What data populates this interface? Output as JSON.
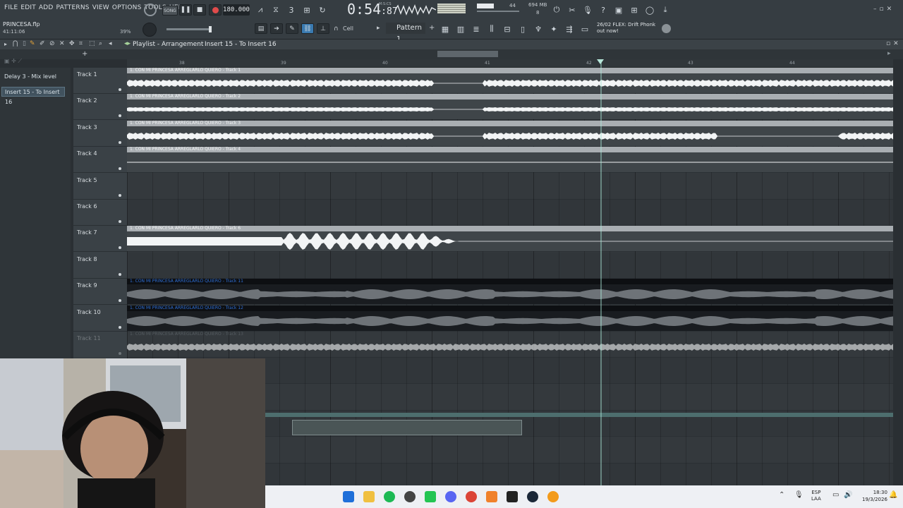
{
  "menu": [
    "FILE",
    "EDIT",
    "ADD",
    "PATTERNS",
    "VIEW",
    "OPTIONS",
    "TOOLS",
    "HELP"
  ],
  "project": {
    "file": "PRINCESA.flp",
    "time": "41:11:06"
  },
  "transport": {
    "mode": "SONG",
    "bpm": "180.000",
    "time": "0:54",
    "time_frac": ":87",
    "time_label": "M:S:CS"
  },
  "monitor": {
    "memory": "694 MB",
    "cpu": "44",
    "voices": "8"
  },
  "cpu_percent": "39%",
  "pattern": {
    "snap": "Cell",
    "name": "Pattern 1"
  },
  "news": {
    "line1": "26/02  FLEX: Drift Phonk",
    "line2": "out now!"
  },
  "playlist": {
    "title": "Playlist - Arrangement",
    "crumb": "Insert 15 - To Insert 16"
  },
  "left_tabs": [
    "Delay 3 - Mix level",
    "Insert 15 - To Insert 16"
  ],
  "ruler_ticks": [
    "38",
    "39",
    "40",
    "41",
    "42",
    "43",
    "44"
  ],
  "tracks": [
    {
      "name": "Track 1"
    },
    {
      "name": "Track 2"
    },
    {
      "name": "Track 3"
    },
    {
      "name": "Track 4"
    },
    {
      "name": "Track 5"
    },
    {
      "name": "Track 6"
    },
    {
      "name": "Track 7"
    },
    {
      "name": "Track 8"
    },
    {
      "name": "Track 9"
    },
    {
      "name": "Track 10"
    },
    {
      "name": "Track 11"
    }
  ],
  "clips": [
    {
      "label": "1. CON MI PRINCESA ARREGLARLO QUIERO - Track 1"
    },
    {
      "label": "1. CON MI PRINCESA ARREGLARLO QUIERO - Track 2"
    },
    {
      "label": "1. CON MI PRINCESA ARREGLARLO QUIERO - Track 3"
    },
    {
      "label": "1. CON MI PRINCESA ARREGLARLO QUIERO - Track 4"
    },
    {
      "label": "1. CON MI PRINCESA ARREGLARLO QUIERO - Track 6"
    },
    {
      "label": "1. CON MI PRINCESA ARREGLARLO QUIERO - Track 11"
    },
    {
      "label": "1. CON MI PRINCESA ARREGLARLO QUIERO - Track 12"
    },
    {
      "label": "1. CON MI PRINCESA ARREGLARLO QUIERO - Track 13"
    }
  ],
  "taskbar": {
    "lang1": "ESP",
    "lang2": "LAA",
    "clock": "18:30",
    "date": "19/3/2026"
  },
  "colors": {
    "clip_gray": "#9aa0a4",
    "clip_dark": "#0f1114",
    "accent_blue": "#2f6fd6"
  }
}
